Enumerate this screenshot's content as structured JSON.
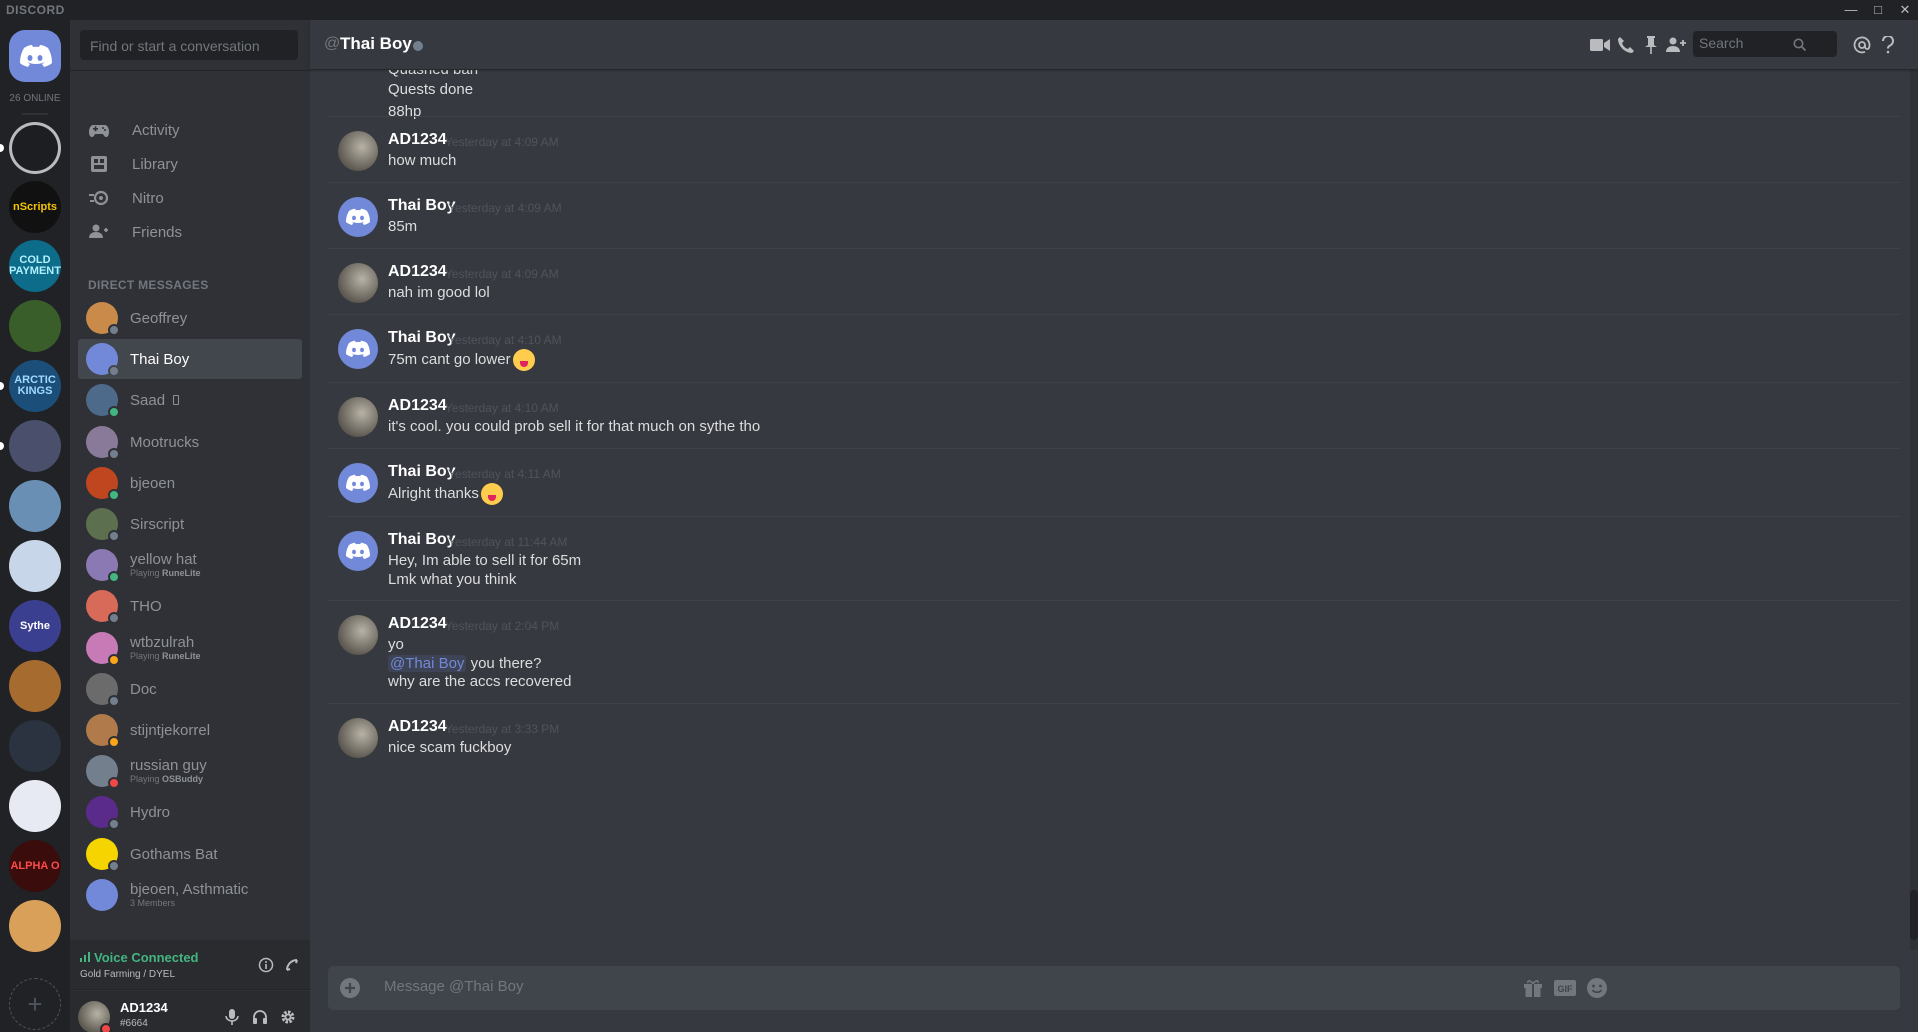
{
  "titlebar": {
    "brand": "DISCORD",
    "minimize": "—",
    "maximize": "□",
    "close": "✕"
  },
  "guilds": {
    "online_count": "26 ONLINE",
    "items": [
      {
        "label": "",
        "color": "#1c1e22",
        "ring": "#b9bbbe"
      },
      {
        "label": "nScripts",
        "color": "#111111",
        "text_color": "#f5c400"
      },
      {
        "label": "COLD PAYMENT",
        "color": "#0c6c8a",
        "text_color": "#b0f1ff"
      },
      {
        "label": "",
        "color": "#3a5e2a"
      },
      {
        "label": "ARCTIC KINGS",
        "color": "#1b4f7a",
        "text_color": "#9fd9ff"
      },
      {
        "label": "",
        "color": "#4a4f6b"
      },
      {
        "label": "",
        "color": "#6a8fb4"
      },
      {
        "label": "",
        "color": "#c7d6e8"
      },
      {
        "label": "Sythe",
        "color": "#3b3f8f",
        "text_color": "#ffffff"
      },
      {
        "label": "",
        "color": "#a66b2f"
      },
      {
        "label": "",
        "color": "#2b3340"
      },
      {
        "label": "",
        "color": "#e7e9f3"
      },
      {
        "label": "ALPHA O",
        "color": "#3a0c0c",
        "text_color": "#ff4b4b"
      },
      {
        "label": "",
        "color": "#d9a05a"
      }
    ],
    "add_label": "+"
  },
  "sidebar": {
    "search_placeholder": "Find or start a conversation",
    "nav": [
      {
        "label": "Activity",
        "icon": "gamepad-icon"
      },
      {
        "label": "Library",
        "icon": "library-icon"
      },
      {
        "label": "Nitro",
        "icon": "nitro-icon"
      },
      {
        "label": "Friends",
        "icon": "friends-icon"
      }
    ],
    "dm_heading": "DIRECT MESSAGES",
    "dms": [
      {
        "name": "Geoffrey",
        "sub": "",
        "sub_app": "",
        "color": "#c98a4a",
        "status": "#747f8d"
      },
      {
        "name": "Thai Boy",
        "sub": "",
        "sub_app": "",
        "color": "#7289da",
        "status": "#747f8d",
        "active": true
      },
      {
        "name": "Saad",
        "sub": "",
        "sub_app": "",
        "color": "#4d6a8a",
        "status": "#43b581",
        "mobile": true
      },
      {
        "name": "Mootrucks",
        "sub": "",
        "sub_app": "",
        "color": "#8a7a9a",
        "status": "#747f8d"
      },
      {
        "name": "bjeoen",
        "sub": "",
        "sub_app": "",
        "color": "#c0461f",
        "status": "#43b581"
      },
      {
        "name": "Sirscript",
        "sub": "",
        "sub_app": "",
        "color": "#5c7050",
        "status": "#747f8d"
      },
      {
        "name": "yellow hat",
        "sub": "Playing ",
        "sub_app": "RuneLite",
        "color": "#8a79b3",
        "status": "#43b581"
      },
      {
        "name": "THO",
        "sub": "",
        "sub_app": "",
        "color": "#d86a5a",
        "status": "#747f8d"
      },
      {
        "name": "wtbzulrah",
        "sub": "Playing ",
        "sub_app": "RuneLite",
        "color": "#c77ab5",
        "status": "#faa61a"
      },
      {
        "name": "Doc",
        "sub": "",
        "sub_app": "",
        "color": "#6b6b6b",
        "status": "#747f8d"
      },
      {
        "name": "stijntjekorrel",
        "sub": "",
        "sub_app": "",
        "color": "#b07a4a",
        "status": "#faa61a"
      },
      {
        "name": "russian guy",
        "sub": "Playing ",
        "sub_app": "OSBuddy",
        "color": "#747f8d",
        "status": "#f04747"
      },
      {
        "name": "Hydro",
        "sub": "",
        "sub_app": "",
        "color": "#5a2b8a",
        "status": "#747f8d"
      },
      {
        "name": "Gothams Bat",
        "sub": "",
        "sub_app": "",
        "color": "#f5d400",
        "status": "#747f8d"
      },
      {
        "name": "bjeoen, Asthmatic",
        "sub": "3 Members",
        "sub_app": "",
        "color": "#7289da",
        "status": "",
        "group": true
      }
    ]
  },
  "voice": {
    "status": "Voice Connected",
    "channel": "Gold Farming / DYEL"
  },
  "user": {
    "name": "AD1234",
    "tag": "#6664"
  },
  "chat": {
    "at": "@",
    "title": "Thai Boy",
    "search_placeholder": "Search",
    "composer_placeholder": "Message @Thai Boy",
    "top_lines": [
      "Quashed ban",
      "Quests done",
      "88hp"
    ],
    "groups": [
      {
        "author": "AD1234",
        "time": "Yesterday at 4:09 AM",
        "avatar": "user",
        "lines": [
          {
            "text": "how much"
          }
        ]
      },
      {
        "author": "Thai Boy",
        "time": "Yesterday at 4:09 AM",
        "avatar": "discord",
        "lines": [
          {
            "text": "85m"
          }
        ]
      },
      {
        "author": "AD1234",
        "time": "Yesterday at 4:09 AM",
        "avatar": "user",
        "lines": [
          {
            "text": "nah im good lol"
          }
        ]
      },
      {
        "author": "Thai Boy",
        "time": "Yesterday at 4:10 AM",
        "avatar": "discord",
        "lines": [
          {
            "text": "75m cant go lower",
            "emoji": true
          }
        ]
      },
      {
        "author": "AD1234",
        "time": "Yesterday at 4:10 AM",
        "avatar": "user",
        "lines": [
          {
            "text": "it's cool. you could prob sell it for that much on sythe tho"
          }
        ]
      },
      {
        "author": "Thai Boy",
        "time": "Yesterday at 4:11 AM",
        "avatar": "discord",
        "lines": [
          {
            "text": "Alright thanks",
            "emoji": true
          }
        ]
      },
      {
        "author": "Thai Boy",
        "time": "Yesterday at 11:44 AM",
        "avatar": "discord",
        "lines": [
          {
            "text": "Hey, Im able to sell it for 65m"
          },
          {
            "text": "Lmk what you think"
          }
        ]
      },
      {
        "author": "AD1234",
        "time": "Yesterday at 2:04 PM",
        "avatar": "user",
        "lines": [
          {
            "text": "yo"
          },
          {
            "mention": "@Thai Boy",
            "text": " you there?"
          },
          {
            "text": "why are the accs recovered"
          }
        ]
      },
      {
        "author": "AD1234",
        "time": "Yesterday at 3:33 PM",
        "avatar": "user",
        "lines": [
          {
            "text": "nice scam fuckboy"
          }
        ]
      }
    ]
  },
  "colors": {
    "blurple": "#7289da",
    "online": "#43b581",
    "idle": "#faa61a",
    "dnd": "#f04747",
    "offline": "#747f8d"
  }
}
